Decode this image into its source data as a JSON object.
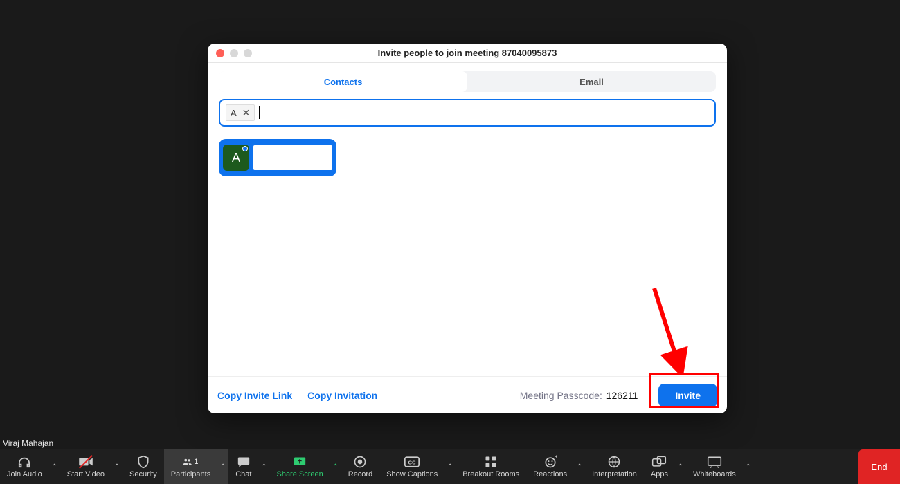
{
  "modal": {
    "title": "Invite people to join meeting 87040095873",
    "tabs": {
      "contacts": "Contacts",
      "email": "Email"
    },
    "chip_text": "A",
    "contact_avatar_letter": "A",
    "footer": {
      "copy_link": "Copy Invite Link",
      "copy_invitation": "Copy Invitation",
      "passcode_label": "Meeting Passcode:",
      "passcode_value": "126211",
      "invite": "Invite"
    }
  },
  "user_name": "Viraj Mahajan",
  "toolbar": {
    "join_audio": "Join Audio",
    "start_video": "Start Video",
    "security": "Security",
    "participants": "Participants",
    "participants_count": "1",
    "chat": "Chat",
    "share_screen": "Share Screen",
    "record": "Record",
    "show_captions": "Show Captions",
    "breakout_rooms": "Breakout Rooms",
    "reactions": "Reactions",
    "interpretation": "Interpretation",
    "apps": "Apps",
    "whiteboards": "Whiteboards",
    "end": "End"
  }
}
